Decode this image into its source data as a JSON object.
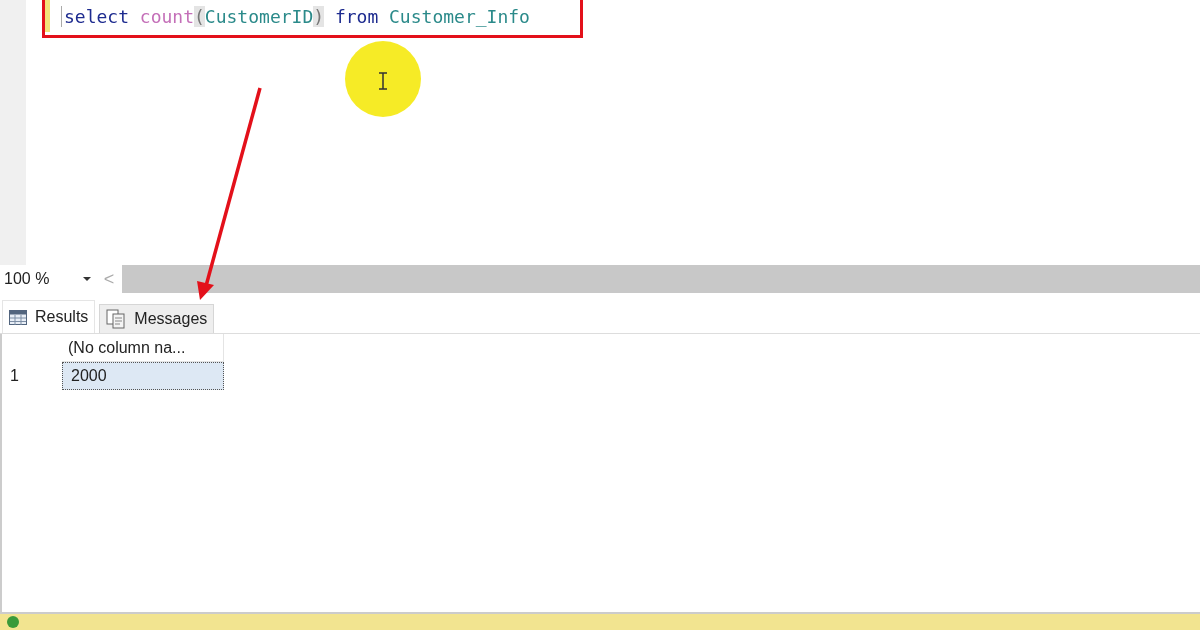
{
  "editor": {
    "tokens": [
      {
        "kind": "keyword",
        "text": "select"
      },
      {
        "kind": "function",
        "text": "count"
      },
      {
        "kind": "open_paren",
        "text": "("
      },
      {
        "kind": "identifier",
        "text": "CustomerID"
      },
      {
        "kind": "close_paren",
        "text": ")"
      },
      {
        "kind": "keyword",
        "text": "from"
      },
      {
        "kind": "identifier",
        "text": "Customer_Info"
      }
    ]
  },
  "zoom": {
    "value": "100 %",
    "scroll_left": "<"
  },
  "tabs": [
    {
      "label": "Results",
      "selected": true,
      "kind": "grid"
    },
    {
      "label": "Messages",
      "selected": false,
      "kind": "messages"
    }
  ],
  "results": {
    "columns": [
      "(No column na..."
    ],
    "rows": [
      {
        "number": "1",
        "cells": [
          "2000"
        ],
        "selected": true
      }
    ]
  }
}
